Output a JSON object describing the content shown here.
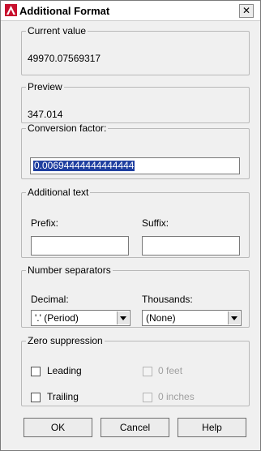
{
  "window": {
    "title": "Additional Format",
    "close_glyph": "✕",
    "icon": "autocad-icon"
  },
  "current_value": {
    "legend": "Current value",
    "value": "49970.07569317"
  },
  "preview": {
    "legend": "Preview",
    "value": "347.014"
  },
  "conversion_factor": {
    "legend": "Conversion factor:",
    "value": "0.00694444444444444"
  },
  "additional_text": {
    "legend": "Additional text",
    "prefix_label": "Prefix:",
    "prefix_value": "",
    "suffix_label": "Suffix:",
    "suffix_value": ""
  },
  "number_separators": {
    "legend": "Number separators",
    "decimal_label": "Decimal:",
    "decimal_value": "'.' (Period)",
    "thousands_label": "Thousands:",
    "thousands_value": "(None)"
  },
  "zero_suppression": {
    "legend": "Zero suppression",
    "leading": "Leading",
    "trailing": "Trailing",
    "zero_feet": "0 feet",
    "zero_inches": "0 inches"
  },
  "buttons": {
    "ok": "OK",
    "cancel": "Cancel",
    "help": "Help"
  }
}
